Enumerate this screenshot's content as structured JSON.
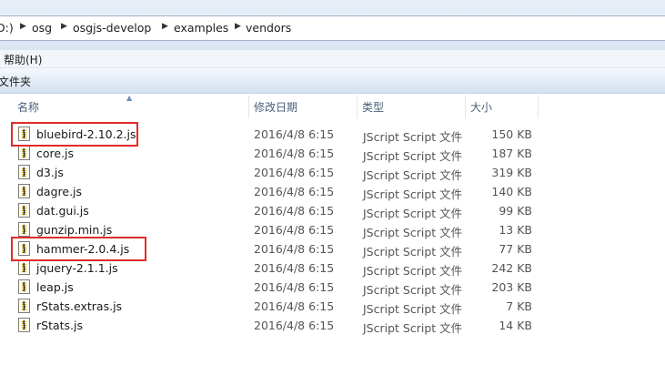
{
  "address": {
    "crumbs": [
      "D:)",
      "osg",
      "osgjs-develop",
      "examples",
      "vendors"
    ]
  },
  "menu": {
    "help_label": "帮助(H)"
  },
  "toolbar": {
    "folder_label": "文件夹"
  },
  "columns": {
    "name": "名称",
    "date": "修改日期",
    "type": "类型",
    "size": "大小"
  },
  "files": [
    {
      "name": "bluebird-2.10.2.js",
      "date": "2016/4/8 6:15",
      "type": "JScript Script 文件",
      "size": "150 KB",
      "highlighted": true
    },
    {
      "name": "core.js",
      "date": "2016/4/8 6:15",
      "type": "JScript Script 文件",
      "size": "187 KB",
      "highlighted": false
    },
    {
      "name": "d3.js",
      "date": "2016/4/8 6:15",
      "type": "JScript Script 文件",
      "size": "319 KB",
      "highlighted": false
    },
    {
      "name": "dagre.js",
      "date": "2016/4/8 6:15",
      "type": "JScript Script 文件",
      "size": "140 KB",
      "highlighted": false
    },
    {
      "name": "dat.gui.js",
      "date": "2016/4/8 6:15",
      "type": "JScript Script 文件",
      "size": "99 KB",
      "highlighted": false
    },
    {
      "name": "gunzip.min.js",
      "date": "2016/4/8 6:15",
      "type": "JScript Script 文件",
      "size": "13 KB",
      "highlighted": false
    },
    {
      "name": "hammer-2.0.4.js",
      "date": "2016/4/8 6:15",
      "type": "JScript Script 文件",
      "size": "77 KB",
      "highlighted": true
    },
    {
      "name": "jquery-2.1.1.js",
      "date": "2016/4/8 6:15",
      "type": "JScript Script 文件",
      "size": "242 KB",
      "highlighted": false
    },
    {
      "name": "leap.js",
      "date": "2016/4/8 6:15",
      "type": "JScript Script 文件",
      "size": "203 KB",
      "highlighted": false
    },
    {
      "name": "rStats.extras.js",
      "date": "2016/4/8 6:15",
      "type": "JScript Script 文件",
      "size": "7 KB",
      "highlighted": false
    },
    {
      "name": "rStats.js",
      "date": "2016/4/8 6:15",
      "type": "JScript Script 文件",
      "size": "14 KB",
      "highlighted": false
    }
  ],
  "colors": {
    "highlight": "#e02b2b",
    "header_text": "#4c607a"
  },
  "icons": {
    "file": "jscript-file-icon",
    "breadcrumb_separator": "triangle-right-icon",
    "sort": "sort-ascending-icon"
  }
}
